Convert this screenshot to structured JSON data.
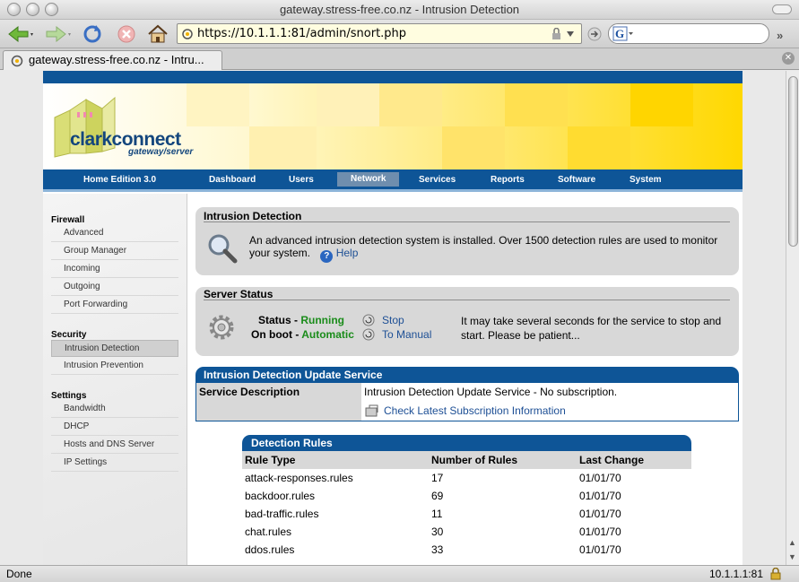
{
  "window": {
    "title": "gateway.stress-free.co.nz - Intrusion Detection"
  },
  "toolbar": {
    "url": "https://10.1.1.1:81/admin/snort.php",
    "search_placeholder": ""
  },
  "tab": {
    "label": "gateway.stress-free.co.nz - Intru..."
  },
  "status_bar": {
    "left": "Done",
    "right": "10.1.1.1:81"
  },
  "site": {
    "logo_word": "clarkconnect",
    "logo_sub": "gateway/server",
    "edition": "Home Edition 3.0",
    "nav": [
      "Dashboard",
      "Users",
      "Network",
      "Services",
      "Reports",
      "Software",
      "System"
    ],
    "active_nav": "Network"
  },
  "sidebar": {
    "sections": [
      {
        "title": "Firewall",
        "items": [
          "Advanced",
          "Group Manager",
          "Incoming",
          "Outgoing",
          "Port Forwarding"
        ]
      },
      {
        "title": "Security",
        "items": [
          "Intrusion Detection",
          "Intrusion Prevention"
        ]
      },
      {
        "title": "Settings",
        "items": [
          "Bandwidth",
          "DHCP",
          "Hosts and DNS Server",
          "IP Settings"
        ]
      }
    ],
    "active_item": "Intrusion Detection"
  },
  "intro": {
    "title": "Intrusion Detection",
    "text": "An advanced intrusion detection system is installed. Over 1500 detection rules are used to monitor your system.",
    "help": "Help"
  },
  "server_status": {
    "title": "Server Status",
    "status_label": "Status -",
    "status_value": "Running",
    "boot_label": "On boot -",
    "boot_value": "Automatic",
    "stop": "Stop",
    "to_manual": "To Manual",
    "note": "It may take several seconds for the service to stop and start.  Please be patient..."
  },
  "update_service": {
    "title": "Intrusion Detection Update Service",
    "label": "Service Description",
    "value": "Intrusion Detection Update Service - No subscription.",
    "link": "Check Latest Subscription Information"
  },
  "rules": {
    "title": "Detection Rules",
    "columns": [
      "Rule Type",
      "Number of Rules",
      "Last Change"
    ],
    "rows": [
      [
        "attack-responses.rules",
        "17",
        "01/01/70"
      ],
      [
        "backdoor.rules",
        "69",
        "01/01/70"
      ],
      [
        "bad-traffic.rules",
        "11",
        "01/01/70"
      ],
      [
        "chat.rules",
        "30",
        "01/01/70"
      ],
      [
        "ddos.rules",
        "33",
        "01/01/70"
      ]
    ]
  }
}
